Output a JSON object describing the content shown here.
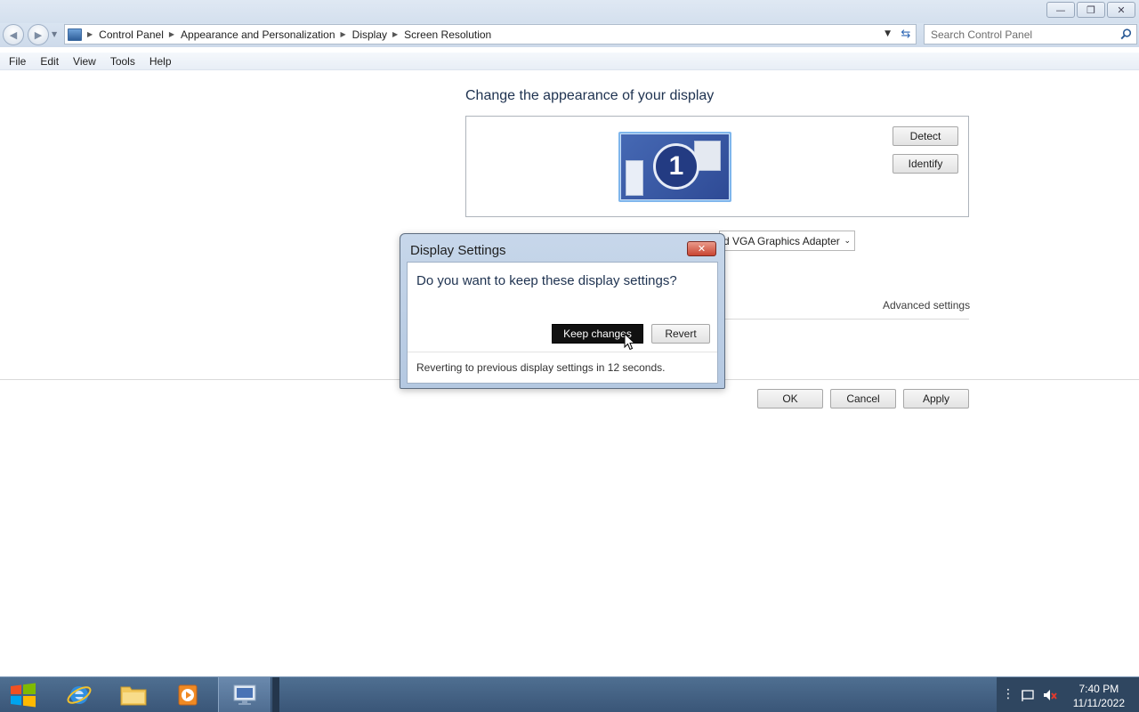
{
  "window": {
    "controls": [
      "minimize",
      "restore",
      "close"
    ]
  },
  "address": {
    "breadcrumbs": [
      "Control Panel",
      "Appearance and Personalization",
      "Display",
      "Screen Resolution"
    ],
    "search_placeholder": "Search Control Panel"
  },
  "menu": [
    "File",
    "Edit",
    "View",
    "Tools",
    "Help"
  ],
  "main": {
    "heading": "Change the appearance of your display",
    "monitor_number": "1",
    "detect_label": "Detect",
    "identify_label": "Identify",
    "adapter_value": "d VGA Graphics Adapter",
    "advanced_link": "Advanced settings",
    "ok_label": "OK",
    "cancel_label": "Cancel",
    "apply_label": "Apply"
  },
  "dialog": {
    "title": "Display Settings",
    "question": "Do you want to keep these display settings?",
    "keep_label": "Keep changes",
    "revert_label": "Revert",
    "countdown": "Reverting to previous display settings in 12 seconds."
  },
  "taskbar": {
    "apps": [
      "internet-explorer",
      "file-explorer",
      "media-player",
      "control-panel"
    ],
    "time": "7:40 PM",
    "date": "11/11/2022"
  },
  "colors": {
    "title_gradient": "#d4e0ee",
    "dialog_frame": "#b4c8e1",
    "close_red": "#c94532",
    "taskbar": "#3a5678",
    "heading_blue": "#1e3250"
  }
}
